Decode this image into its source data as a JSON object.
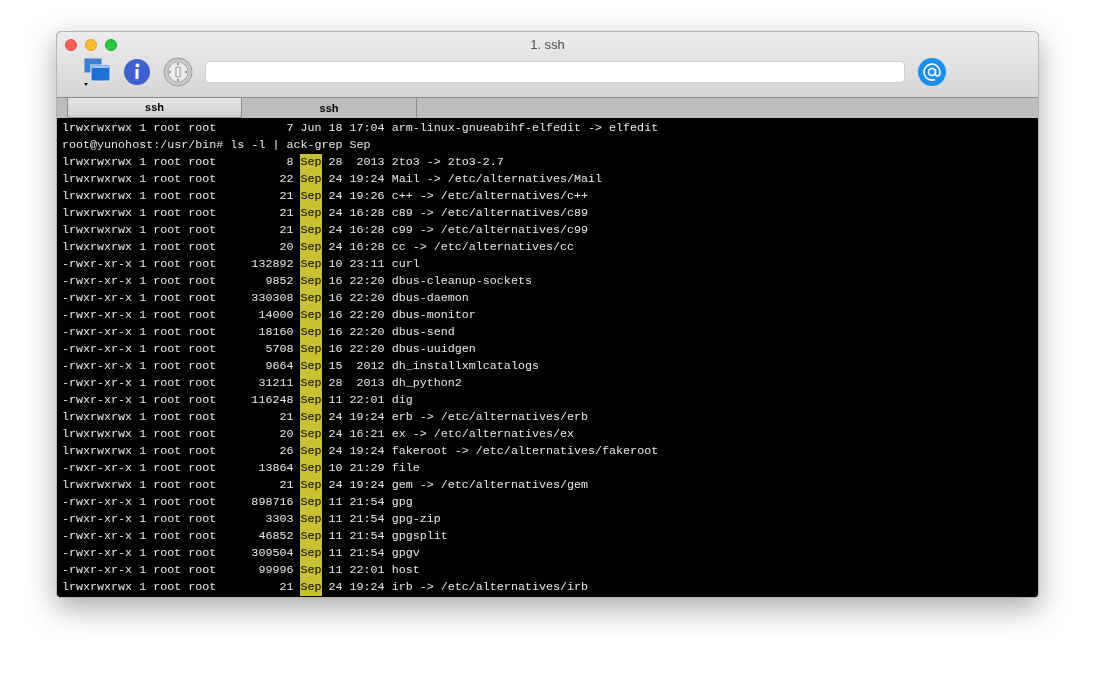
{
  "window": {
    "title": "1. ssh"
  },
  "tabs": [
    {
      "label": "ssh",
      "selected": true
    },
    {
      "label": "ssh",
      "selected": false
    }
  ],
  "terminal": {
    "lines": [
      {
        "parts": [
          {
            "text": "lrwxrwxrwx 1 root root          7 Jun 18 17:04 arm-linux-gnueabihf-elfedit -> elfedit",
            "highlighted": false
          }
        ]
      },
      {
        "parts": [
          {
            "text": "root@yunohost:/usr/bin# ls -l | ack-grep Sep",
            "highlighted": false
          }
        ]
      },
      {
        "parts": [
          {
            "text": "lrwxrwxrwx 1 root root          8 ",
            "highlighted": false
          },
          {
            "text": "Sep",
            "highlighted": true
          },
          {
            "text": " 28  2013 2to3 -> 2to3-2.7",
            "highlighted": false
          }
        ]
      },
      {
        "parts": [
          {
            "text": "lrwxrwxrwx 1 root root         22 ",
            "highlighted": false
          },
          {
            "text": "Sep",
            "highlighted": true
          },
          {
            "text": " 24 19:24 Mail -> /etc/alternatives/Mail",
            "highlighted": false
          }
        ]
      },
      {
        "parts": [
          {
            "text": "lrwxrwxrwx 1 root root         21 ",
            "highlighted": false
          },
          {
            "text": "Sep",
            "highlighted": true
          },
          {
            "text": " 24 19:26 c++ -> /etc/alternatives/c++",
            "highlighted": false
          }
        ]
      },
      {
        "parts": [
          {
            "text": "lrwxrwxrwx 1 root root         21 ",
            "highlighted": false
          },
          {
            "text": "Sep",
            "highlighted": true
          },
          {
            "text": " 24 16:28 c89 -> /etc/alternatives/c89",
            "highlighted": false
          }
        ]
      },
      {
        "parts": [
          {
            "text": "lrwxrwxrwx 1 root root         21 ",
            "highlighted": false
          },
          {
            "text": "Sep",
            "highlighted": true
          },
          {
            "text": " 24 16:28 c99 -> /etc/alternatives/c99",
            "highlighted": false
          }
        ]
      },
      {
        "parts": [
          {
            "text": "lrwxrwxrwx 1 root root         20 ",
            "highlighted": false
          },
          {
            "text": "Sep",
            "highlighted": true
          },
          {
            "text": " 24 16:28 cc -> /etc/alternatives/cc",
            "highlighted": false
          }
        ]
      },
      {
        "parts": [
          {
            "text": "-rwxr-xr-x 1 root root     132892 ",
            "highlighted": false
          },
          {
            "text": "Sep",
            "highlighted": true
          },
          {
            "text": " 10 23:11 curl",
            "highlighted": false
          }
        ]
      },
      {
        "parts": [
          {
            "text": "-rwxr-xr-x 1 root root       9852 ",
            "highlighted": false
          },
          {
            "text": "Sep",
            "highlighted": true
          },
          {
            "text": " 16 22:20 dbus-cleanup-sockets",
            "highlighted": false
          }
        ]
      },
      {
        "parts": [
          {
            "text": "-rwxr-xr-x 1 root root     330308 ",
            "highlighted": false
          },
          {
            "text": "Sep",
            "highlighted": true
          },
          {
            "text": " 16 22:20 dbus-daemon",
            "highlighted": false
          }
        ]
      },
      {
        "parts": [
          {
            "text": "-rwxr-xr-x 1 root root      14000 ",
            "highlighted": false
          },
          {
            "text": "Sep",
            "highlighted": true
          },
          {
            "text": " 16 22:20 dbus-monitor",
            "highlighted": false
          }
        ]
      },
      {
        "parts": [
          {
            "text": "-rwxr-xr-x 1 root root      18160 ",
            "highlighted": false
          },
          {
            "text": "Sep",
            "highlighted": true
          },
          {
            "text": " 16 22:20 dbus-send",
            "highlighted": false
          }
        ]
      },
      {
        "parts": [
          {
            "text": "-rwxr-xr-x 1 root root       5708 ",
            "highlighted": false
          },
          {
            "text": "Sep",
            "highlighted": true
          },
          {
            "text": " 16 22:20 dbus-uuidgen",
            "highlighted": false
          }
        ]
      },
      {
        "parts": [
          {
            "text": "-rwxr-xr-x 1 root root       9664 ",
            "highlighted": false
          },
          {
            "text": "Sep",
            "highlighted": true
          },
          {
            "text": " 15  2012 dh_installxmlcatalogs",
            "highlighted": false
          }
        ]
      },
      {
        "parts": [
          {
            "text": "-rwxr-xr-x 1 root root      31211 ",
            "highlighted": false
          },
          {
            "text": "Sep",
            "highlighted": true
          },
          {
            "text": " 28  2013 dh_python2",
            "highlighted": false
          }
        ]
      },
      {
        "parts": [
          {
            "text": "-rwxr-xr-x 1 root root     116248 ",
            "highlighted": false
          },
          {
            "text": "Sep",
            "highlighted": true
          },
          {
            "text": " 11 22:01 dig",
            "highlighted": false
          }
        ]
      },
      {
        "parts": [
          {
            "text": "lrwxrwxrwx 1 root root         21 ",
            "highlighted": false
          },
          {
            "text": "Sep",
            "highlighted": true
          },
          {
            "text": " 24 19:24 erb -> /etc/alternatives/erb",
            "highlighted": false
          }
        ]
      },
      {
        "parts": [
          {
            "text": "lrwxrwxrwx 1 root root         20 ",
            "highlighted": false
          },
          {
            "text": "Sep",
            "highlighted": true
          },
          {
            "text": " 24 16:21 ex -> /etc/alternatives/ex",
            "highlighted": false
          }
        ]
      },
      {
        "parts": [
          {
            "text": "lrwxrwxrwx 1 root root         26 ",
            "highlighted": false
          },
          {
            "text": "Sep",
            "highlighted": true
          },
          {
            "text": " 24 19:24 fakeroot -> /etc/alternatives/fakeroot",
            "highlighted": false
          }
        ]
      },
      {
        "parts": [
          {
            "text": "-rwxr-xr-x 1 root root      13864 ",
            "highlighted": false
          },
          {
            "text": "Sep",
            "highlighted": true
          },
          {
            "text": " 10 21:29 file",
            "highlighted": false
          }
        ]
      },
      {
        "parts": [
          {
            "text": "lrwxrwxrwx 1 root root         21 ",
            "highlighted": false
          },
          {
            "text": "Sep",
            "highlighted": true
          },
          {
            "text": " 24 19:24 gem -> /etc/alternatives/gem",
            "highlighted": false
          }
        ]
      },
      {
        "parts": [
          {
            "text": "-rwxr-xr-x 1 root root     898716 ",
            "highlighted": false
          },
          {
            "text": "Sep",
            "highlighted": true
          },
          {
            "text": " 11 21:54 gpg",
            "highlighted": false
          }
        ]
      },
      {
        "parts": [
          {
            "text": "-rwxr-xr-x 1 root root       3303 ",
            "highlighted": false
          },
          {
            "text": "Sep",
            "highlighted": true
          },
          {
            "text": " 11 21:54 gpg-zip",
            "highlighted": false
          }
        ]
      },
      {
        "parts": [
          {
            "text": "-rwxr-xr-x 1 root root      46852 ",
            "highlighted": false
          },
          {
            "text": "Sep",
            "highlighted": true
          },
          {
            "text": " 11 21:54 gpgsplit",
            "highlighted": false
          }
        ]
      },
      {
        "parts": [
          {
            "text": "-rwxr-xr-x 1 root root     309504 ",
            "highlighted": false
          },
          {
            "text": "Sep",
            "highlighted": true
          },
          {
            "text": " 11 21:54 gpgv",
            "highlighted": false
          }
        ]
      },
      {
        "parts": [
          {
            "text": "-rwxr-xr-x 1 root root      99996 ",
            "highlighted": false
          },
          {
            "text": "Sep",
            "highlighted": true
          },
          {
            "text": " 11 22:01 host",
            "highlighted": false
          }
        ]
      },
      {
        "parts": [
          {
            "text": "lrwxrwxrwx 1 root root         21 ",
            "highlighted": false
          },
          {
            "text": "Sep",
            "highlighted": true
          },
          {
            "text": " 24 19:24 irb -> /etc/alternatives/irb",
            "highlighted": false
          }
        ]
      }
    ]
  }
}
